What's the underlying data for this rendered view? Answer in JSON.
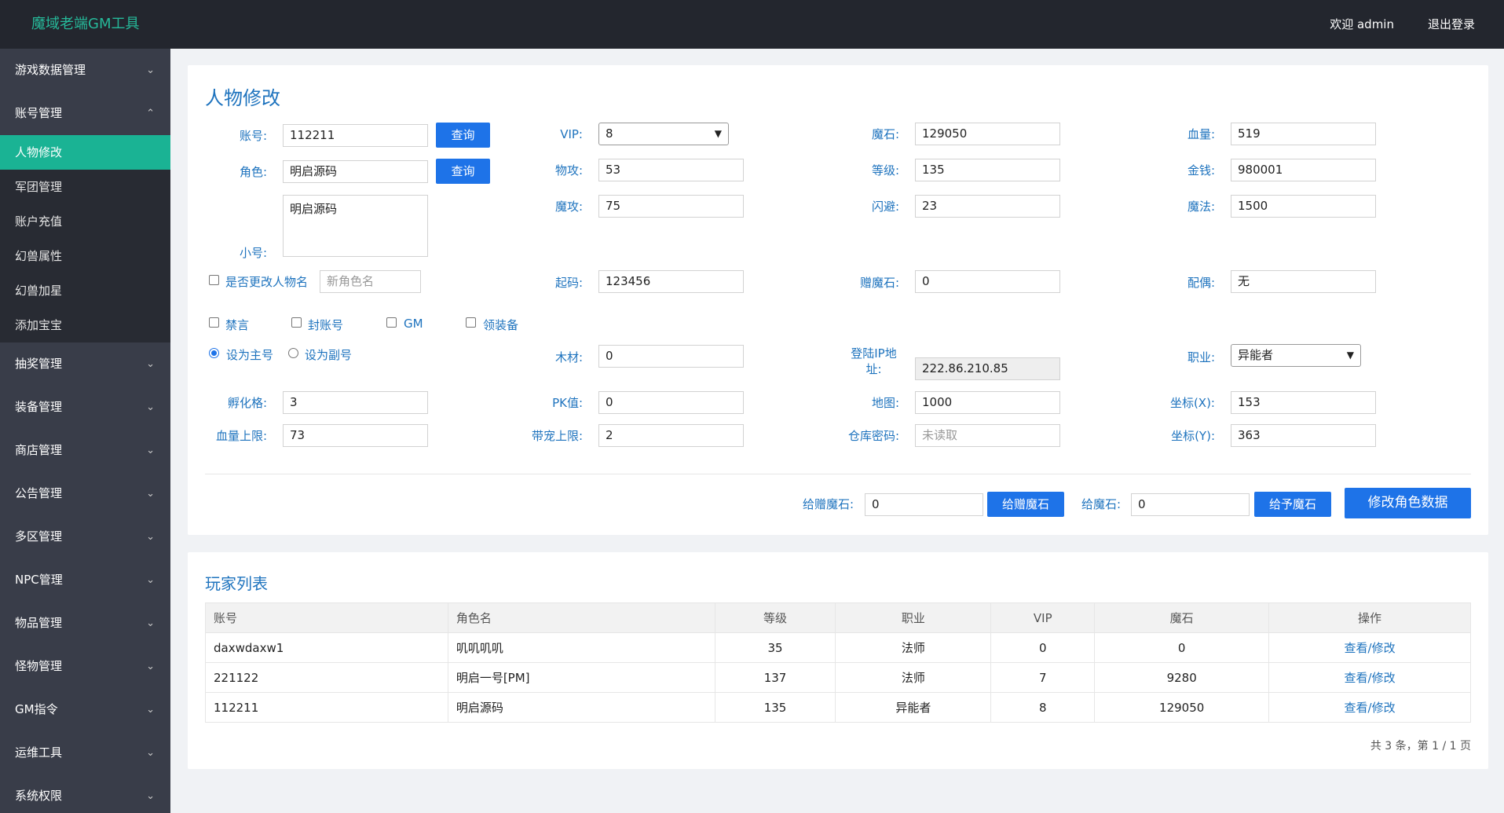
{
  "header": {
    "brand": "魔域老端GM工具",
    "welcome": "欢迎 admin",
    "logout": "退出登录"
  },
  "sidebar": {
    "group_before": [
      {
        "label": "游戏数据管理",
        "chev": "⌄"
      }
    ],
    "open_group": {
      "label": "账号管理",
      "chev": "⌃"
    },
    "sub_items": [
      {
        "label": "人物修改"
      },
      {
        "label": "军团管理"
      },
      {
        "label": "账户充值"
      },
      {
        "label": "幻兽属性"
      },
      {
        "label": "幻兽加星"
      },
      {
        "label": "添加宝宝"
      }
    ],
    "groups_after": [
      {
        "label": "抽奖管理",
        "chev": "⌄"
      },
      {
        "label": "装备管理",
        "chev": "⌄"
      },
      {
        "label": "商店管理",
        "chev": "⌄"
      },
      {
        "label": "公告管理",
        "chev": "⌄"
      },
      {
        "label": "多区管理",
        "chev": "⌄"
      },
      {
        "label": "NPC管理",
        "chev": "⌄"
      },
      {
        "label": "物品管理",
        "chev": "⌄"
      },
      {
        "label": "怪物管理",
        "chev": "⌄"
      },
      {
        "label": "GM指令",
        "chev": "⌄"
      },
      {
        "label": "运维工具",
        "chev": "⌄"
      },
      {
        "label": "系统权限",
        "chev": "⌄"
      }
    ]
  },
  "edit": {
    "title": "人物修改",
    "account": {
      "label": "账号:",
      "value": "112211",
      "btn": "查询"
    },
    "role": {
      "label": "角色:",
      "value": "明启源码",
      "btn": "查询"
    },
    "alt": {
      "label": "小号:",
      "value": "明启源码"
    },
    "rename": {
      "label": "是否更改人物名",
      "placeholder": "新角色名"
    },
    "vip": {
      "label": "VIP:",
      "value": "8"
    },
    "patk": {
      "label": "物攻:",
      "value": "53"
    },
    "matk": {
      "label": "魔攻:",
      "value": "75"
    },
    "qima": {
      "label": "起码:",
      "value": "123456"
    },
    "magicstone": {
      "label": "魔石:",
      "value": "129050"
    },
    "level": {
      "label": "等级:",
      "value": "135"
    },
    "dodge": {
      "label": "闪避:",
      "value": "23"
    },
    "giftstone": {
      "label": "赠魔石:",
      "value": "0"
    },
    "hp": {
      "label": "血量:",
      "value": "519"
    },
    "money": {
      "label": "金钱:",
      "value": "980001"
    },
    "mp": {
      "label": "魔法:",
      "value": "1500"
    },
    "spouse": {
      "label": "配偶:",
      "value": "无"
    },
    "checks": {
      "ban": "禁言",
      "seal": "封账号",
      "gm": "GM",
      "equip": "领装备"
    },
    "radios": {
      "main": "设为主号",
      "sub": "设为副号"
    },
    "wood": {
      "label": "木材:",
      "value": "0"
    },
    "ip": {
      "label": "登陆IP地址:",
      "value": "222.86.210.85"
    },
    "job": {
      "label": "职业:",
      "value": "异能者"
    },
    "hatch": {
      "label": "孵化格:",
      "value": "3"
    },
    "pk": {
      "label": "PK值:",
      "value": "0"
    },
    "map": {
      "label": "地图:",
      "value": "1000"
    },
    "cx": {
      "label": "坐标(X):",
      "value": "153"
    },
    "hpmax": {
      "label": "血量上限:",
      "value": "73"
    },
    "petmax": {
      "label": "带宠上限:",
      "value": "2"
    },
    "wh": {
      "label": "仓库密码:",
      "placeholder": "未读取"
    },
    "cy": {
      "label": "坐标(Y):",
      "value": "363"
    },
    "give_gift": {
      "label": "给赠魔石:",
      "value": "0",
      "btn": "给赠魔石"
    },
    "give_stone": {
      "label": "给魔石:",
      "value": "0",
      "btn": "给予魔石"
    },
    "submit": "修改角色数据"
  },
  "players": {
    "title": "玩家列表",
    "columns": [
      "账号",
      "角色名",
      "等级",
      "职业",
      "VIP",
      "魔石",
      "操作"
    ],
    "rows": [
      [
        "daxwdaxw1",
        "叽叽叽叽",
        "35",
        "法师",
        "0",
        "0",
        "查看/修改"
      ],
      [
        "221122",
        "明启一号[PM]",
        "137",
        "法师",
        "7",
        "9280",
        "查看/修改"
      ],
      [
        "112211",
        "明启源码",
        "135",
        "异能者",
        "8",
        "129050",
        "查看/修改"
      ]
    ],
    "pager": "共 3 条，第 1 / 1 页"
  }
}
